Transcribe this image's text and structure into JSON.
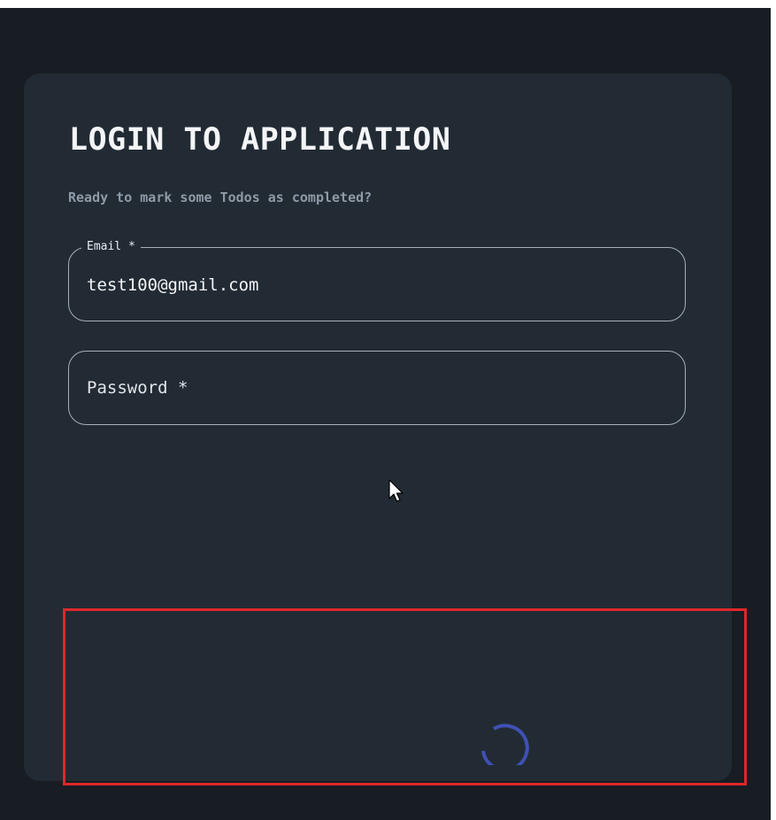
{
  "login": {
    "title": "LOGIN TO APPLICATION",
    "subtitle": "Ready to mark some Todos as completed?"
  },
  "email_field": {
    "label": "Email *",
    "value": "test100@gmail.com"
  },
  "password_field": {
    "label": "Password *"
  },
  "colors": {
    "background": "#181d23",
    "card": "#222b34",
    "spinner": "#3f51b5",
    "highlight": "#e0262b"
  },
  "icons": {
    "pointer": "mouse-pointer-icon",
    "loading": "loading-spinner-icon"
  }
}
